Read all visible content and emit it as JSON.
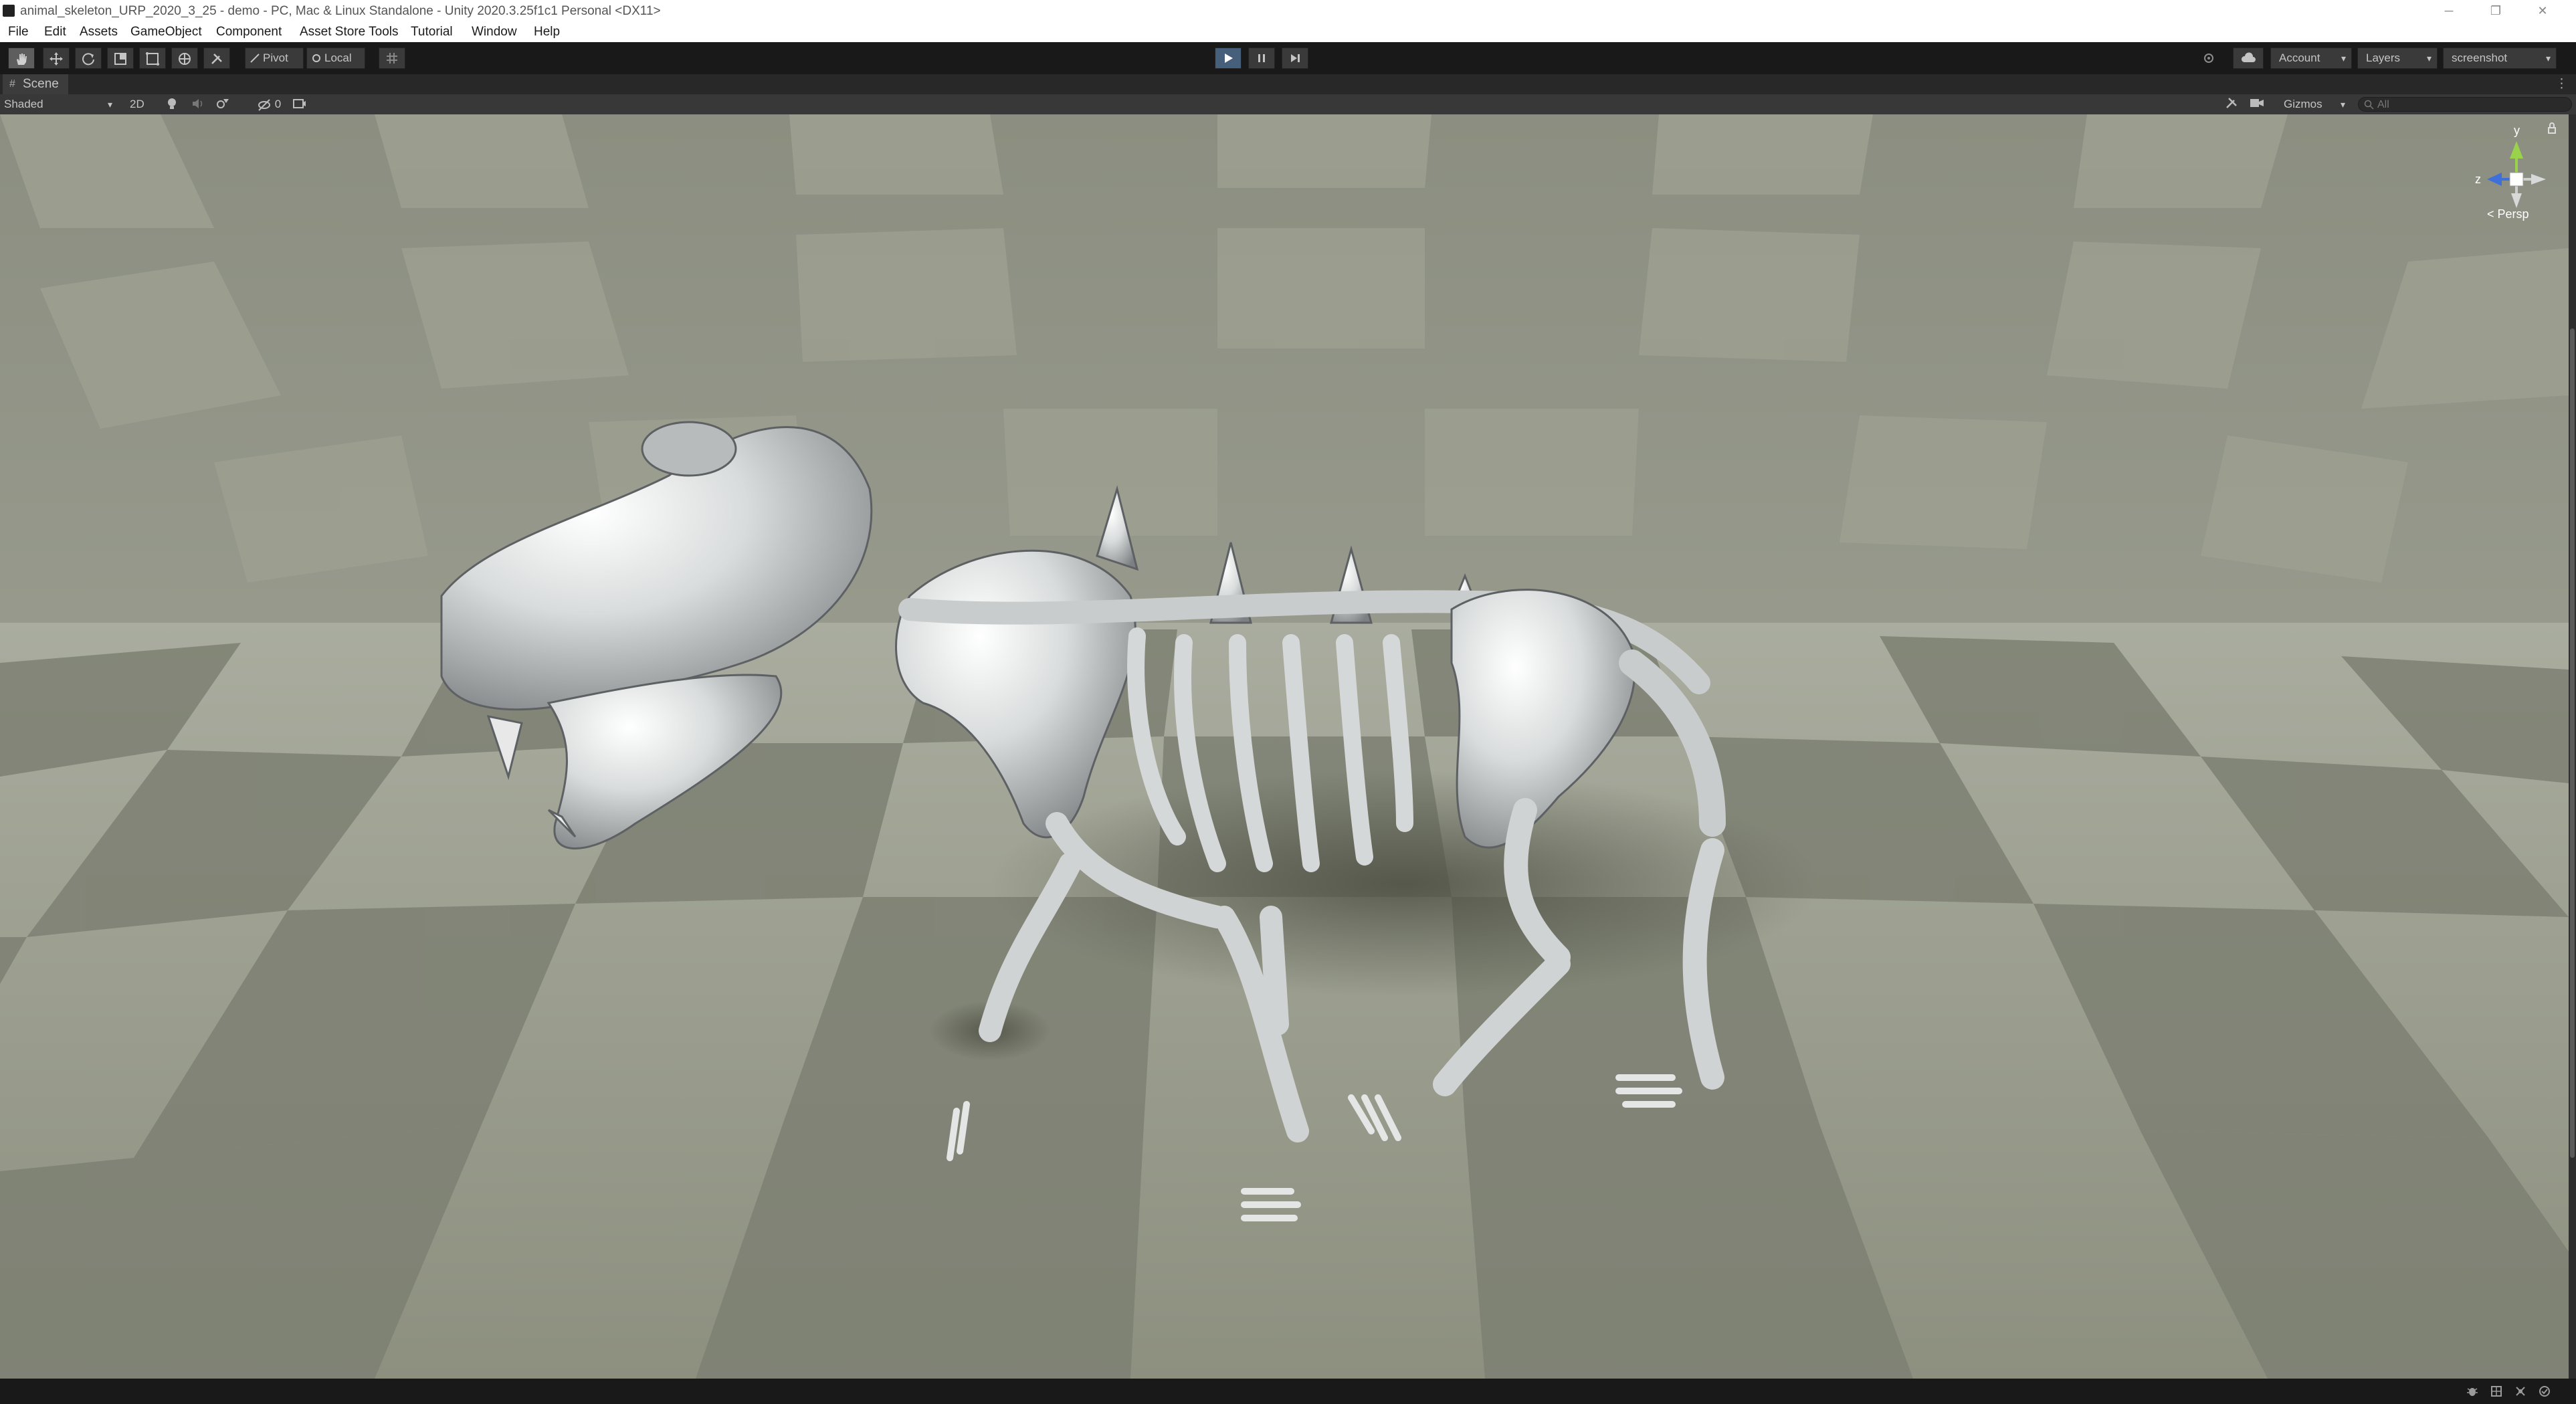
{
  "window": {
    "title": "animal_skeleton_URP_2020_3_25 - demo - PC, Mac & Linux Standalone - Unity 2020.3.25f1c1 Personal <DX11>",
    "controls": [
      "─",
      "❐",
      "✕"
    ]
  },
  "menu": {
    "items": [
      "File",
      "Edit",
      "Assets",
      "GameObject",
      "Component",
      "Asset Store Tools",
      "Tutorial",
      "Window",
      "Help"
    ]
  },
  "toolbar": {
    "pivot_label": "Pivot",
    "local_label": "Local",
    "account_label": "Account",
    "layers_label": "Layers",
    "layout_label": "screenshot"
  },
  "scene_tab": {
    "label": "Scene"
  },
  "scene_toolbar": {
    "shading_mode": "Shaded",
    "mode_2d": "2D",
    "hidden_count": "0",
    "gizmos_label": "Gizmos",
    "search_placeholder": "All"
  },
  "gizmo": {
    "y_label": "y",
    "z_label": "z",
    "projection_label": "< Persp"
  },
  "colors": {
    "play_active": "#46607c",
    "gizmo_y": "#9ad34b",
    "gizmo_z": "#3f6fd8",
    "gizmo_x": "#d9503f"
  },
  "icons": {
    "tools": [
      "hand-icon",
      "move-icon",
      "rotate-icon",
      "scale-icon",
      "rect-tool-icon",
      "transform-icon",
      "custom-tool-icon"
    ],
    "playback": [
      "play-icon",
      "pause-icon",
      "step-icon"
    ],
    "status": [
      "bug-icon",
      "lighting-icon",
      "cache-icon",
      "progress-icon"
    ]
  }
}
